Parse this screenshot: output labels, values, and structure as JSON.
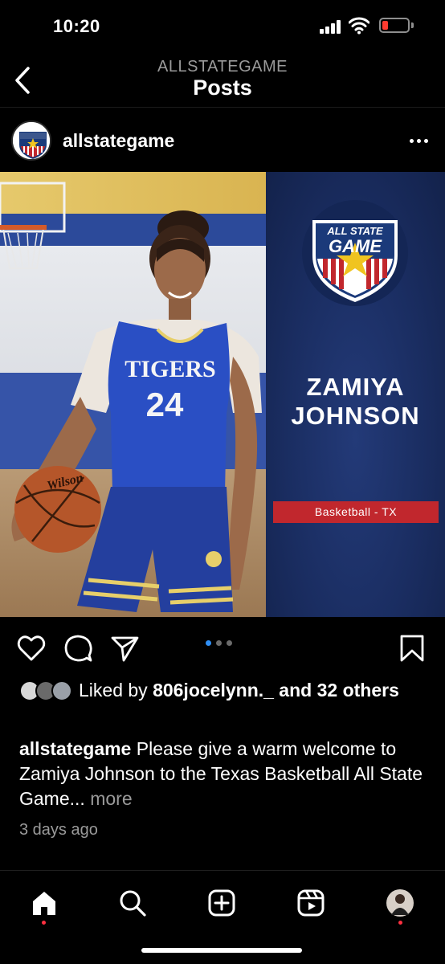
{
  "status_bar": {
    "time": "10:20",
    "icons": [
      "signal-icon",
      "wifi-icon",
      "battery-low-icon"
    ],
    "battery_color": "#ff3b30"
  },
  "header": {
    "back_icon": "chevron-left-icon",
    "account": "ALLSTATEGAME",
    "title": "Posts"
  },
  "post": {
    "author": "allstategame",
    "more_icon": "ellipsis-icon",
    "image": {
      "jersey_text": "TIGERS",
      "jersey_number": "24",
      "logo_text_top": "ALL STATE",
      "logo_text_bottom": "GAME",
      "player_first_name": "ZAMIYA",
      "player_last_name": "JOHNSON",
      "sport_label": "Basketball - TX",
      "panel_color": "#1a2d61",
      "banner_color": "#c1272d"
    },
    "carousel": {
      "count": 3,
      "active_index": 0,
      "active_color": "#2f8ff5"
    },
    "actions": [
      "heart-icon",
      "comment-icon",
      "share-icon",
      "bookmark-icon"
    ],
    "likes": {
      "prefix": "Liked by ",
      "user": "806jocelynn._",
      "suffix": " and 32 others"
    },
    "caption": {
      "author": "allstategame",
      "text": " Please give a warm welcome to Zamiya Johnson to the Texas Basketball All State Game...",
      "more_label": " more"
    },
    "timestamp": "3 days ago"
  },
  "bottom_nav": {
    "items": [
      "home-icon",
      "search-icon",
      "create-icon",
      "reels-icon",
      "profile-icon"
    ],
    "active": "home-icon",
    "notification_color": "#ff3040"
  }
}
